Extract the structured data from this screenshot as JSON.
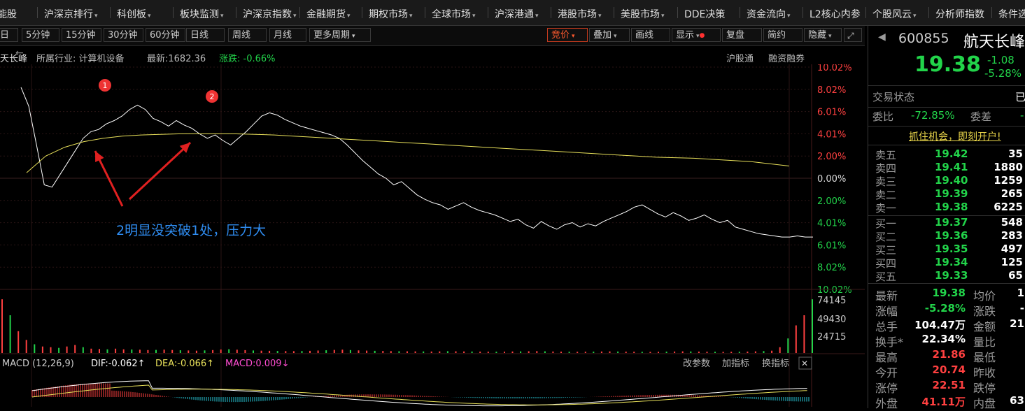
{
  "nav": [
    "能股",
    "沪深京排行",
    "科创板",
    "板块监测",
    "沪深京指数",
    "金融期货",
    "期权市场",
    "全球市场",
    "沪深港通",
    "港股市场",
    "美股市场",
    "DDE决策",
    "资金流向",
    "L2核心内参",
    "个股风云",
    "分析师指数",
    "条件选"
  ],
  "toolbar": {
    "periods": [
      "日",
      "5分钟",
      "15分钟",
      "30分钟",
      "60分钟",
      "日线",
      "周线",
      "月线",
      "更多周期"
    ],
    "right": [
      "竞价",
      "叠加",
      "画线",
      "显示",
      "复盘",
      "简约",
      "隐藏"
    ]
  },
  "infobar": {
    "name": "天长峰",
    "industry": "所属行业: 计算机设备",
    "latest": "最新:1682.36",
    "change": "涨跌: -0.66%",
    "right1": "沪股通",
    "right2": "融资融券"
  },
  "axis": {
    "pct_labels": [
      "10.02%",
      "8.02%",
      "6.01%",
      "4.01%",
      "2.00%",
      "0.00%",
      "2.00%",
      "4.01%",
      "6.01%",
      "8.02%",
      "10.02%"
    ],
    "vol_labels": [
      "74145",
      "49430",
      "24715"
    ]
  },
  "chart_data": {
    "type": "line",
    "y_unit": "%",
    "ylim": [
      -10.02,
      10.02
    ],
    "price_pct": [
      8.2,
      6.5,
      3.0,
      -0.6,
      -0.8,
      0.3,
      1.4,
      2.5,
      3.6,
      4.2,
      4.4,
      4.9,
      5.2,
      5.6,
      6.2,
      6.6,
      6.2,
      5.4,
      5.1,
      4.7,
      5.2,
      4.8,
      4.5,
      4.0,
      3.6,
      3.9,
      3.4,
      3.0,
      3.6,
      4.2,
      4.9,
      5.6,
      5.9,
      5.7,
      5.3,
      5.0,
      4.7,
      4.5,
      4.3,
      4.1,
      3.9,
      3.6,
      3.0,
      2.3,
      1.6,
      1.0,
      0.4,
      0.0,
      -0.6,
      -0.3,
      -0.9,
      -1.5,
      -1.9,
      -2.2,
      -2.4,
      -2.8,
      -2.5,
      -2.2,
      -2.6,
      -2.9,
      -3.1,
      -3.3,
      -3.6,
      -3.9,
      -3.7,
      -4.2,
      -4.5,
      -3.9,
      -4.3,
      -4.6,
      -4.2,
      -4.0,
      -4.4,
      -4.1,
      -4.3,
      -3.9,
      -3.6,
      -3.3,
      -3.0,
      -2.6,
      -2.4,
      -2.8,
      -3.2,
      -3.5,
      -3.1,
      -3.4,
      -3.8,
      -3.6,
      -3.3,
      -3.7,
      -4.0,
      -3.8,
      -4.4,
      -4.6,
      -4.8,
      -5.0,
      -5.1,
      -5.2,
      -5.3,
      -5.3,
      -5.2,
      -5.3,
      -5.3
    ],
    "avg_pct": [
      0.5,
      2.0,
      2.8,
      3.3,
      3.6,
      3.8,
      3.9,
      3.95,
      4.0,
      4.0,
      4.0,
      4.0,
      3.95,
      3.9,
      3.8,
      3.7,
      3.6,
      3.5,
      3.4,
      3.3,
      3.2,
      3.1,
      3.0,
      2.9,
      2.8,
      2.7,
      2.6,
      2.5,
      2.4,
      2.3,
      2.2,
      2.1,
      2.0,
      1.9,
      1.85,
      1.8,
      1.7,
      1.6,
      1.5,
      1.3,
      1.1
    ],
    "volume": [
      74000,
      52000,
      30000,
      18000,
      12000,
      9000,
      8000,
      7000,
      9000,
      11000,
      8000,
      6000,
      5500,
      5000,
      6000,
      5000,
      4800,
      4500,
      4000,
      4200,
      4600,
      4100,
      3800,
      3500,
      3200,
      3600,
      4000,
      4800,
      5200,
      4500,
      3900,
      3500,
      3200,
      3000,
      2800,
      2600,
      2500,
      2700,
      3000,
      3400,
      3800,
      4200,
      4600,
      4000,
      3600,
      3300,
      3000,
      2800,
      2600,
      2400,
      2300,
      2200,
      2100,
      2000,
      2200,
      2500,
      2300,
      2100,
      2000,
      1900,
      1800,
      1700,
      1800,
      2000,
      2200,
      2400,
      2600,
      2300,
      2000,
      1800,
      1700,
      1600,
      1700,
      1800,
      2000,
      2200,
      2000,
      1800,
      1700,
      1600,
      1500,
      1600,
      1800,
      2000,
      2200,
      2100,
      1900,
      1700,
      1600,
      1500,
      1600,
      1700,
      1900,
      2200,
      2600,
      3200,
      8000,
      20000,
      38000,
      52000,
      74000
    ]
  },
  "markers": [
    {
      "label": "1"
    },
    {
      "label": "2"
    }
  ],
  "annotation": "2明显没突破1处，压力大",
  "macd": {
    "title": "MACD (12,26,9)",
    "dif": "DIF:-0.062↑",
    "dea": "DEA:-0.066↑",
    "macd": "MACD:0.009↓",
    "btn1": "改参数",
    "btn2": "加指标",
    "btn3": "换指标",
    "close": "✕"
  },
  "panel": {
    "code": "600855",
    "name": "航天长峰",
    "price": "19.38",
    "chg": "-1.08",
    "chg_pct": "-5.28%",
    "status_label": "交易状态",
    "status_val": "已",
    "webi_label": "委比",
    "webi_val": "-72.85%",
    "weicha_label": "委差",
    "weicha_val": "-",
    "promo": "抓住机会，即刻开户!",
    "asks": [
      {
        "label": "卖五",
        "price": "19.42",
        "vol": "35"
      },
      {
        "label": "卖四",
        "price": "19.41",
        "vol": "1880"
      },
      {
        "label": "卖三",
        "price": "19.40",
        "vol": "1259"
      },
      {
        "label": "卖二",
        "price": "19.39",
        "vol": "265"
      },
      {
        "label": "卖一",
        "price": "19.38",
        "vol": "6225"
      }
    ],
    "bids": [
      {
        "label": "买一",
        "price": "19.37",
        "vol": "548"
      },
      {
        "label": "买二",
        "price": "19.36",
        "vol": "283"
      },
      {
        "label": "买三",
        "price": "19.35",
        "vol": "497"
      },
      {
        "label": "买四",
        "price": "19.34",
        "vol": "125"
      },
      {
        "label": "买五",
        "price": "19.33",
        "vol": "65"
      }
    ],
    "stats": [
      {
        "l1": "最新",
        "v1": "19.38",
        "c1": "green",
        "l2": "均价",
        "v2": "1"
      },
      {
        "l1": "涨幅",
        "v1": "-5.28%",
        "c1": "green",
        "l2": "涨跌",
        "v2": "-"
      },
      {
        "l1": "总手",
        "v1": "104.47万",
        "c1": "white",
        "l2": "金额",
        "v2": "21"
      },
      {
        "l1": "换手*",
        "v1": "22.34%",
        "c1": "white",
        "l2": "量比",
        "v2": ""
      },
      {
        "l1": "最高",
        "v1": "21.86",
        "c1": "red",
        "l2": "最低",
        "v2": ""
      },
      {
        "l1": "今开",
        "v1": "20.74",
        "c1": "red",
        "l2": "昨收",
        "v2": ""
      },
      {
        "l1": "涨停",
        "v1": "22.51",
        "c1": "red",
        "l2": "跌停",
        "v2": ""
      },
      {
        "l1": "外盘",
        "v1": "41.11万",
        "c1": "red",
        "l2": "内盘",
        "v2": "63"
      }
    ]
  },
  "colors": {
    "up": "#ff4040",
    "down": "#22d44a",
    "price_line": "#ffffff",
    "avg_line": "#e8e05a",
    "annot": "#2f8cf0"
  }
}
